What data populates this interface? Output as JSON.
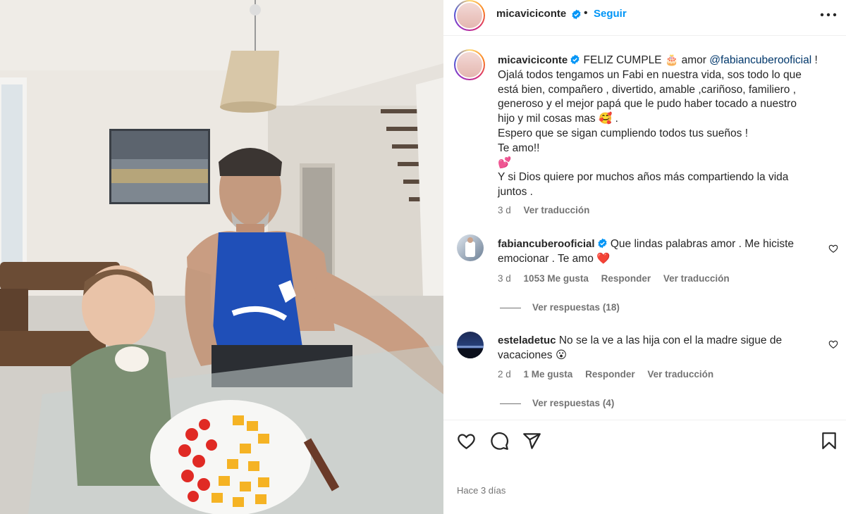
{
  "colors": {
    "link": "#0095f6",
    "mention": "#00376b",
    "muted": "#737373",
    "verified": "#0095f6",
    "heart": "#ed4956"
  },
  "header": {
    "username": "micaviciconte",
    "follow_label": "Seguir",
    "more_icon": "more-horizontal-icon"
  },
  "caption": {
    "username": "micaviciconte",
    "text_start": "FELIZ CUMPLE",
    "cake_emoji": "🎂",
    "text_amor": " amor ",
    "mention": "@fabiancuberooficial",
    "text_excl": " !",
    "line2": "Ojalá todos tengamos un Fabi en nuestra vida, sos todo lo que",
    "line3": "está bien, compañero , divertido, amable ,cariñoso, familiero ,",
    "line4": "generoso y el mejor papá que le pudo haber tocado a nuestro",
    "line5_start": "hijo y mil cosas mas ",
    "line5_emoji": "🥰",
    "line5_end": " .",
    "line6": "Espero que se sigan cumpliendo todos tus sueños !",
    "line7": "Te amo!!",
    "line8_emoji": "💕",
    "line9": "Y si Dios quiere por muchos años más compartiendo la vida",
    "line10": "juntos .",
    "age": "3 d",
    "translate": "Ver traducción"
  },
  "comments": [
    {
      "username": "fabiancuberooficial",
      "verified": true,
      "text_line1": "Que lindas palabras amor . Me hiciste",
      "text_line2": "emocionar . Te amo ",
      "emoji": "❤️",
      "age": "3 d",
      "likes": "1053 Me gusta",
      "reply": "Responder",
      "translate": "Ver traducción",
      "replies": "Ver respuestas (18)"
    },
    {
      "username": "esteladetuc",
      "verified": false,
      "text_line1": "No se la ve a las hija con el la madre sigue de",
      "text_line2": "vacaciones ",
      "emoji": "😮",
      "age": "2 d",
      "likes": "1 Me gusta",
      "reply": "Responder",
      "translate": "Ver traducción",
      "replies": "Ver respuestas (4)"
    }
  ],
  "actions": {
    "like_icon": "heart-icon",
    "comment_icon": "comment-icon",
    "share_icon": "send-icon",
    "save_icon": "bookmark-icon"
  },
  "posted": "Hace 3 días"
}
